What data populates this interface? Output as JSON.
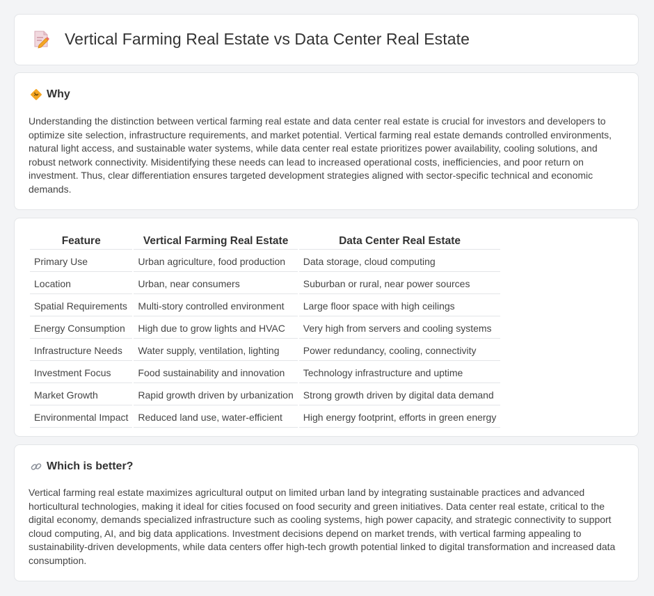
{
  "header": {
    "title": "Vertical Farming Real Estate vs Data Center Real Estate",
    "icon": "document-pencil-icon"
  },
  "why": {
    "title": "Why",
    "icon": "warning-sign-icon",
    "body": "Understanding the distinction between vertical farming real estate and data center real estate is crucial for investors and developers to optimize site selection, infrastructure requirements, and market potential. Vertical farming real estate demands controlled environments, natural light access, and sustainable water systems, while data center real estate prioritizes power availability, cooling solutions, and robust network connectivity. Misidentifying these needs can lead to increased operational costs, inefficiencies, and poor return on investment. Thus, clear differentiation ensures targeted development strategies aligned with sector-specific technical and economic demands."
  },
  "table": {
    "headers": [
      "Feature",
      "Vertical Farming Real Estate",
      "Data Center Real Estate"
    ],
    "rows": [
      [
        "Primary Use",
        "Urban agriculture, food production",
        "Data storage, cloud computing"
      ],
      [
        "Location",
        "Urban, near consumers",
        "Suburban or rural, near power sources"
      ],
      [
        "Spatial Requirements",
        "Multi-story controlled environment",
        "Large floor space with high ceilings"
      ],
      [
        "Energy Consumption",
        "High due to grow lights and HVAC",
        "Very high from servers and cooling systems"
      ],
      [
        "Infrastructure Needs",
        "Water supply, ventilation, lighting",
        "Power redundancy, cooling, connectivity"
      ],
      [
        "Investment Focus",
        "Food sustainability and innovation",
        "Technology infrastructure and uptime"
      ],
      [
        "Market Growth",
        "Rapid growth driven by urbanization",
        "Strong growth driven by digital data demand"
      ],
      [
        "Environmental Impact",
        "Reduced land use, water-efficient",
        "High energy footprint, efforts in green energy"
      ]
    ]
  },
  "better": {
    "title": "Which is better?",
    "icon": "link-icon",
    "body": "Vertical farming real estate maximizes agricultural output on limited urban land by integrating sustainable practices and advanced horticultural technologies, making it ideal for cities focused on food security and green initiatives. Data center real estate, critical to the digital economy, demands specialized infrastructure such as cooling systems, high power capacity, and strategic connectivity to support cloud computing, AI, and big data applications. Investment decisions depend on market trends, with vertical farming appealing to sustainability-driven developments, while data centers offer high-tech growth potential linked to digital transformation and increased data consumption."
  },
  "colors": {
    "page_bg": "#f3f4f6",
    "card_bg": "#ffffff",
    "border": "#e3e5e8",
    "accent_orange": "#f5a623",
    "text": "#333333"
  }
}
